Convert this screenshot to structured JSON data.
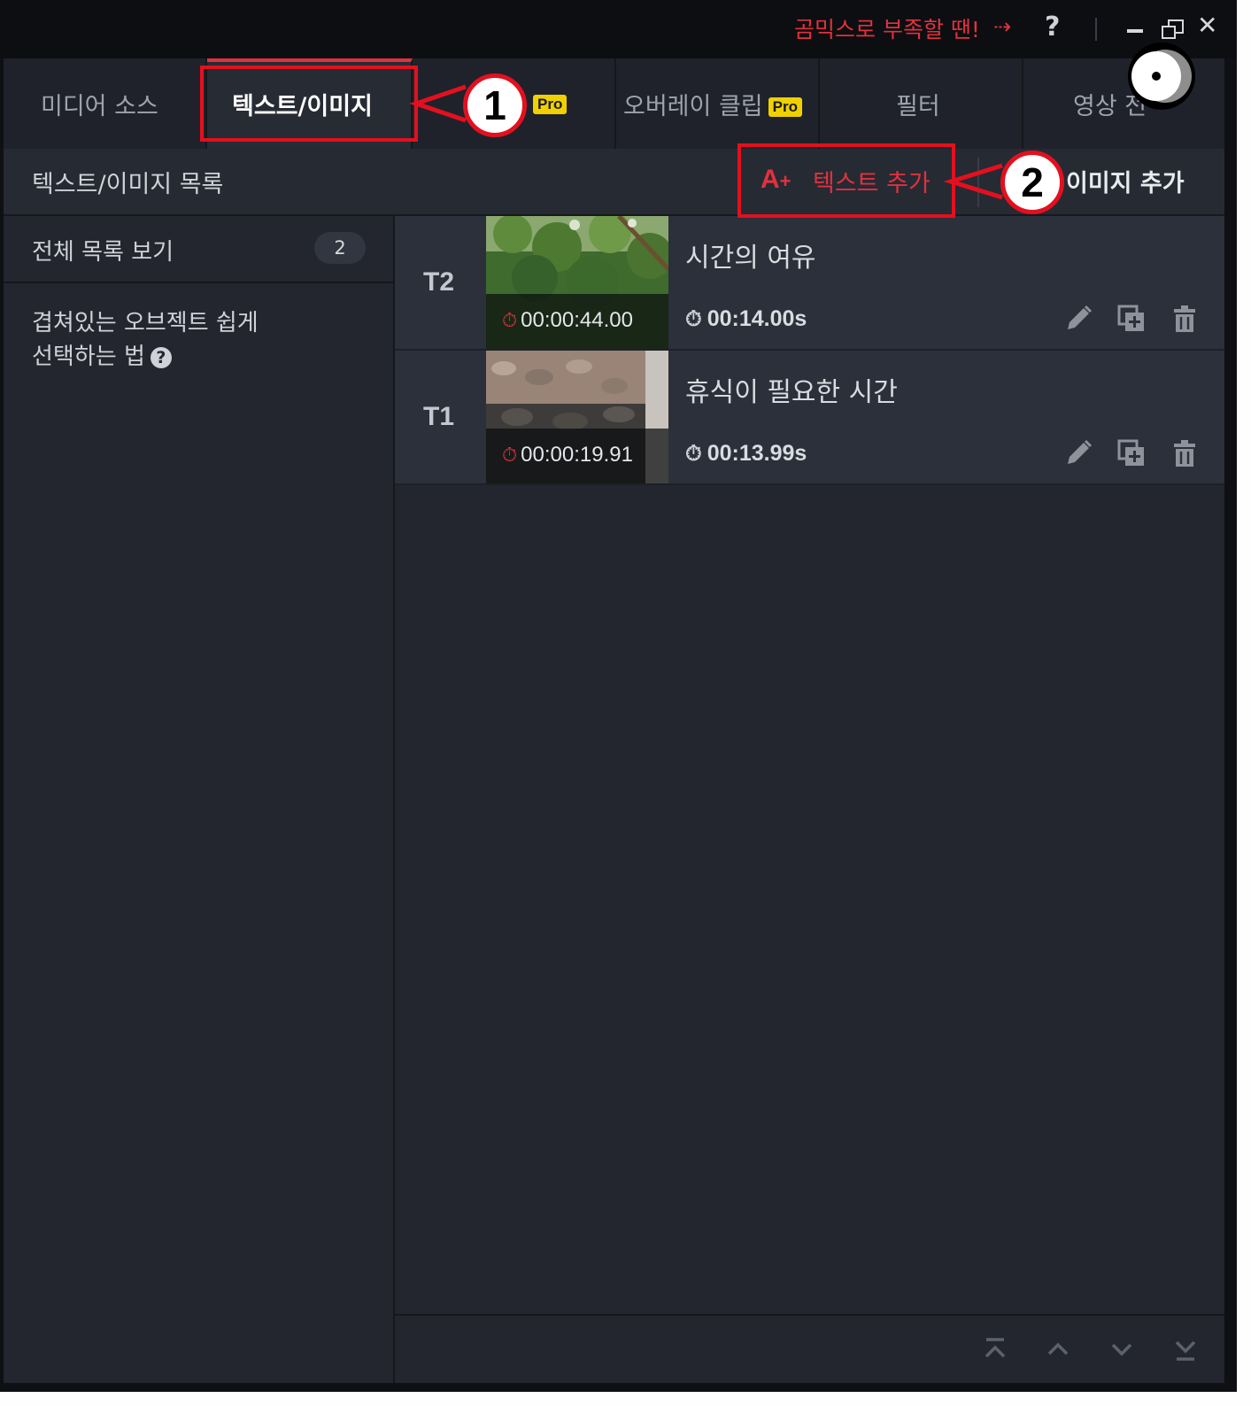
{
  "titlebar": {
    "promo_text": "곰믹스로 부족할 땐!",
    "promo_arrow": "⇢",
    "help": "?",
    "close": "✕"
  },
  "tabs": [
    {
      "label": "미디어 소스",
      "pro": "",
      "active": false
    },
    {
      "label": "텍스트/이미지",
      "pro": "",
      "active": true
    },
    {
      "label": "",
      "pro": "Pro",
      "active": false
    },
    {
      "label": "오버레이 클립",
      "pro": "Pro",
      "active": false
    },
    {
      "label": "필터",
      "pro": "",
      "active": false
    },
    {
      "label": "영상 전",
      "pro": "",
      "active": false
    }
  ],
  "toolbar": {
    "list_title": "텍스트/이미지 목록",
    "add_text_icon": "A",
    "add_text_icon_plus": "+",
    "add_text_label": "텍스트 추가",
    "add_image_label": "이미지 추가"
  },
  "left_panel": {
    "all_list_label": "전체 목록 보기",
    "all_list_count": "2",
    "tip_line1": "겹쳐있는 오브젝트 쉽게",
    "tip_line2": "선택하는 법",
    "tip_icon": "?"
  },
  "items": [
    {
      "id": "T2",
      "thumb_time": "00:00:44.00",
      "title": "시간의 여유",
      "duration": "00:14.00s"
    },
    {
      "id": "T1",
      "thumb_time": "00:00:19.91",
      "title": "휴식이 필요한 시간",
      "duration": "00:13.99s"
    }
  ],
  "icons": {
    "timer": "⏱",
    "edit": "pencil-icon",
    "duplicate": "duplicate-icon",
    "delete": "trash-icon",
    "order": [
      "move-top-icon",
      "move-up-icon",
      "move-down-icon",
      "move-bottom-icon"
    ]
  },
  "annotations": {
    "step1": "1",
    "step2": "2"
  },
  "colors": {
    "accent_red": "#e0323e",
    "annotation_red": "#e3101f",
    "pro_badge": "#f0d000",
    "panel_bg": "#23262f"
  }
}
